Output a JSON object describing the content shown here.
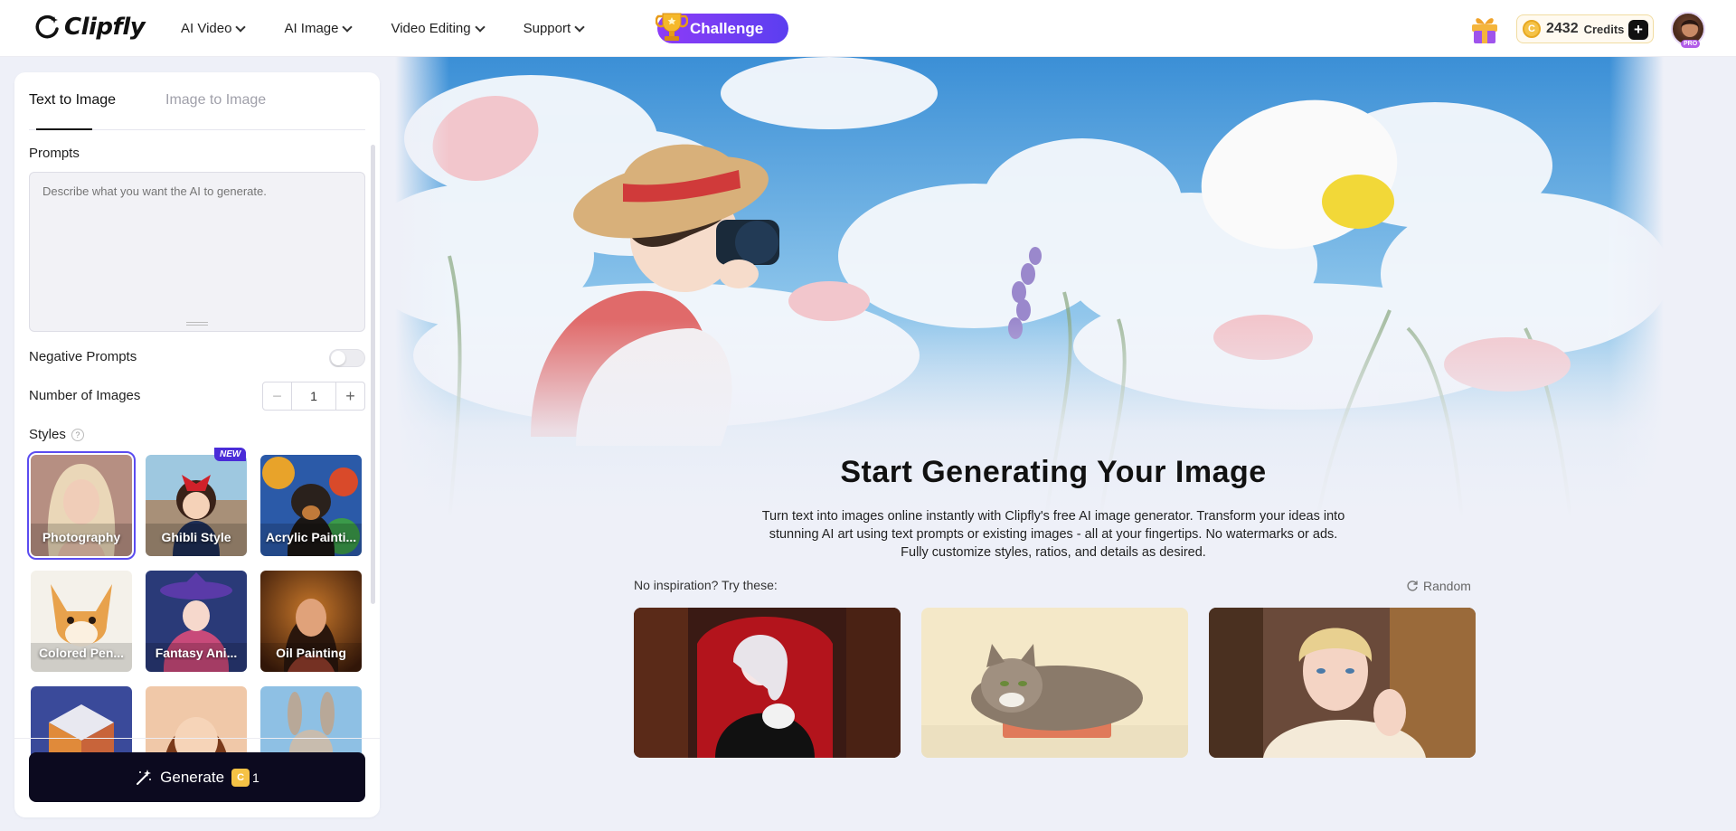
{
  "brand": {
    "name": "Clipfly"
  },
  "nav": {
    "items": [
      {
        "label": "AI Video"
      },
      {
        "label": "AI Image"
      },
      {
        "label": "Video Editing"
      },
      {
        "label": "Support"
      }
    ],
    "challenge_label": "Challenge"
  },
  "account": {
    "credits_value": "2432",
    "credits_label": "Credits",
    "coin_symbol": "C",
    "add_symbol": "+",
    "badge": "PRO"
  },
  "sidebar": {
    "tabs": [
      {
        "label": "Text to Image",
        "active": true
      },
      {
        "label": "Image to Image",
        "active": false
      }
    ],
    "prompts_label": "Prompts",
    "prompt_placeholder": "Describe what you want the AI to generate.",
    "negative_label": "Negative Prompts",
    "negative_enabled": false,
    "count_label": "Number of Images",
    "count_value": "1",
    "minus_symbol": "−",
    "plus_symbol": "+",
    "styles_label": "Styles",
    "help_symbol": "?",
    "new_badge": "NEW",
    "styles": [
      {
        "name": "Photography",
        "selected": true
      },
      {
        "name": "Ghibli Style"
      },
      {
        "name": "Acrylic Painti..."
      },
      {
        "name": "Colored Pen..."
      },
      {
        "name": "Fantasy Ani..."
      },
      {
        "name": "Oil Painting"
      },
      {
        "name": ""
      },
      {
        "name": ""
      },
      {
        "name": ""
      }
    ],
    "generate_label": "Generate",
    "generate_cost": "1",
    "coin_symbol": "C"
  },
  "main": {
    "title": "Start Generating Your Image",
    "subtitle_lines": [
      "Turn text into images online instantly with Clipfly's free AI image generator. Transform your ideas into",
      "stunning AI art using text prompts or existing images - all at your fingertips. No watermarks or ads.",
      "Fully customize styles, ratios, and details as desired."
    ],
    "inspiration_label": "No inspiration? Try these:",
    "random_label": "Random"
  },
  "colors": {
    "accent": "#5b4cf0",
    "challenge": "#7a3cf5",
    "generate_bg": "#0c0a1f",
    "coin": "#f5c245"
  }
}
